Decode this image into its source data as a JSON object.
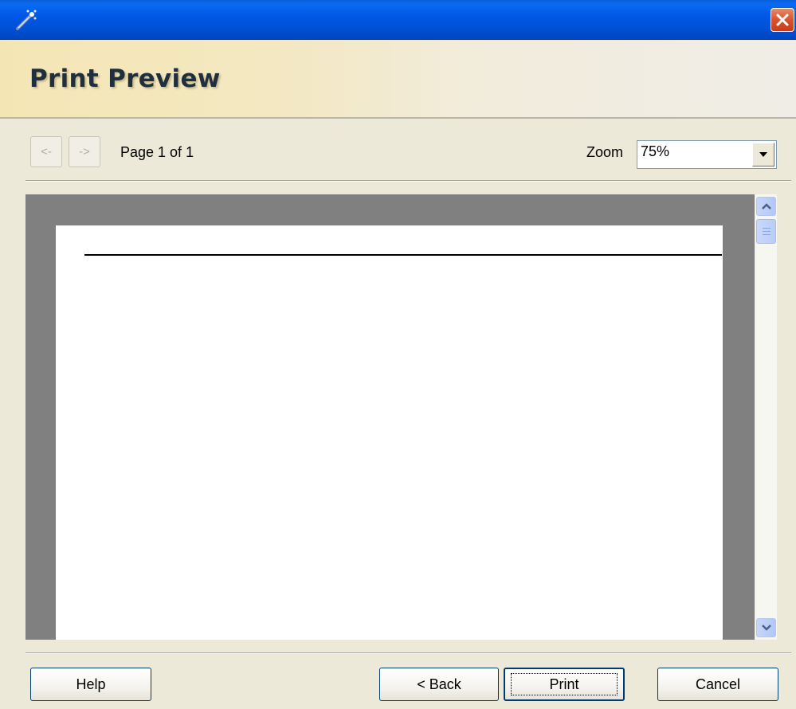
{
  "window": {
    "app_icon": "wand-icon",
    "close_icon": "close-icon",
    "close_color": "#d9532f",
    "titlebar_color": "#0058e6"
  },
  "header": {
    "title": "Print Preview"
  },
  "toolbar": {
    "prev_icon": "arrow-left-icon",
    "next_icon": "arrow-right-icon",
    "prev_glyph": "<-",
    "next_glyph": "->",
    "page_label": "Page 1 of 1",
    "zoom_label": "Zoom",
    "zoom_value": "75%"
  },
  "buttons": {
    "help": "Help",
    "back": "< Back",
    "print": "Print",
    "cancel": "Cancel"
  }
}
